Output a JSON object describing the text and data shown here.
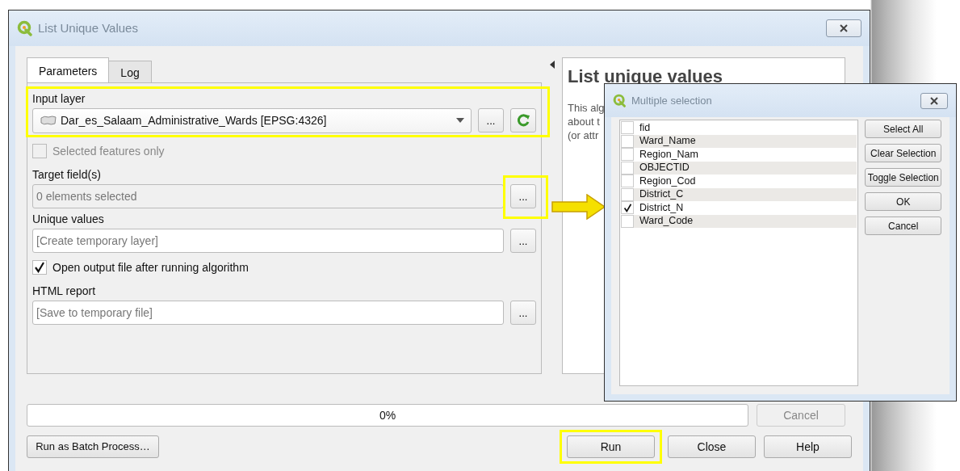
{
  "window": {
    "title": "List Unique Values"
  },
  "tabs": [
    {
      "label": "Parameters",
      "selected": true
    },
    {
      "label": "Log",
      "selected": false
    }
  ],
  "parameters": [
    {
      "kind": "combo",
      "label": "Input layer",
      "value": "Dar_es_Salaam_Administrative_Wards [EPSG:4326]",
      "button": "...",
      "highlighted": true
    },
    {
      "kind": "checkbox",
      "label": "Selected features only",
      "checked": false,
      "disabled": true
    },
    {
      "kind": "field",
      "label": "Target field(s)",
      "value": "0 elements selected",
      "disabled": true,
      "button": "...",
      "button_highlighted": true
    },
    {
      "kind": "field",
      "label": "Unique values",
      "placeholder": "[Create temporary layer]",
      "disabled": false,
      "button": "..."
    },
    {
      "kind": "checkbox",
      "label": "Open output file after running algorithm",
      "checked": true,
      "disabled": false
    },
    {
      "kind": "field",
      "label": "HTML report",
      "placeholder": "[Save to temporary file]",
      "disabled": false,
      "button": "..."
    }
  ],
  "help": {
    "title": "List unique values",
    "lines": [
      "This alg",
      "about t",
      "(or attr"
    ]
  },
  "progress": {
    "text": "0%",
    "level": 0,
    "cancel": {
      "label": "Cancel",
      "disabled": true
    }
  },
  "batch_button": {
    "label": "Run as Batch Process…"
  },
  "buttons": [
    {
      "label": "Run",
      "highlighted": true
    },
    {
      "label": "Close",
      "highlighted": false
    },
    {
      "label": "Help",
      "highlighted": false
    }
  ],
  "dialog": {
    "title": "Multiple selection",
    "items": [
      {
        "label": "fid",
        "checked": false
      },
      {
        "label": "Ward_Name",
        "checked": false
      },
      {
        "label": "Region_Nam",
        "checked": false
      },
      {
        "label": "OBJECTID",
        "checked": false
      },
      {
        "label": "Region_Cod",
        "checked": false
      },
      {
        "label": "District_C",
        "checked": false
      },
      {
        "label": "District_N",
        "checked": true
      },
      {
        "label": "Ward_Code",
        "checked": false
      }
    ],
    "buttons": [
      "Select All",
      "Clear Selection",
      "Toggle Selection",
      "OK",
      "Cancel"
    ]
  }
}
